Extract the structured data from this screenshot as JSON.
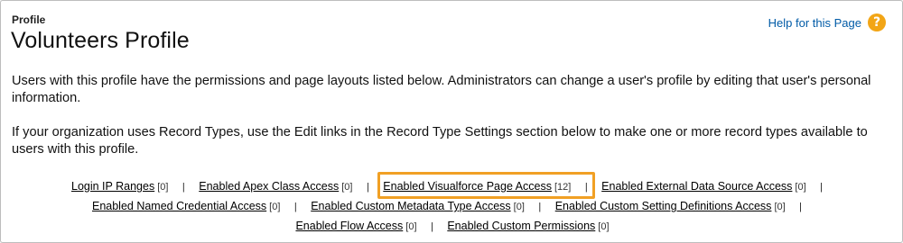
{
  "header": {
    "type_label": "Profile",
    "title": "Volunteers Profile",
    "help_link": "Help for this Page",
    "help_icon": "?"
  },
  "description": {
    "paragraph1": "Users with this profile have the permissions and page layouts listed below. Administrators can change a user's profile by editing that user's personal information.",
    "paragraph2": "If your organization uses Record Types, use the Edit links in the Record Type Settings section below to make one or more record types available to users with this profile."
  },
  "related_links": {
    "separator": "|",
    "rows": [
      [
        {
          "label": "Login IP Ranges",
          "count": "[0]"
        },
        {
          "label": "Enabled Apex Class Access",
          "count": "[0]"
        },
        {
          "label": "Enabled Visualforce Page Access",
          "count": "[12]"
        },
        {
          "label": "Enabled External Data Source Access",
          "count": "[0]"
        }
      ],
      [
        {
          "label": "Enabled Named Credential Access",
          "count": "[0]"
        },
        {
          "label": "Enabled Custom Metadata Type Access",
          "count": "[0]"
        },
        {
          "label": "Enabled Custom Setting Definitions Access",
          "count": "[0]"
        }
      ],
      [
        {
          "label": "Enabled Flow Access",
          "count": "[0]"
        },
        {
          "label": "Enabled Custom Permissions",
          "count": "[0]"
        }
      ]
    ]
  },
  "colors": {
    "highlight": "#f1a024",
    "help_link": "#015ba7",
    "help_icon": "#f2a516"
  },
  "icons": {
    "help": "help-icon"
  }
}
